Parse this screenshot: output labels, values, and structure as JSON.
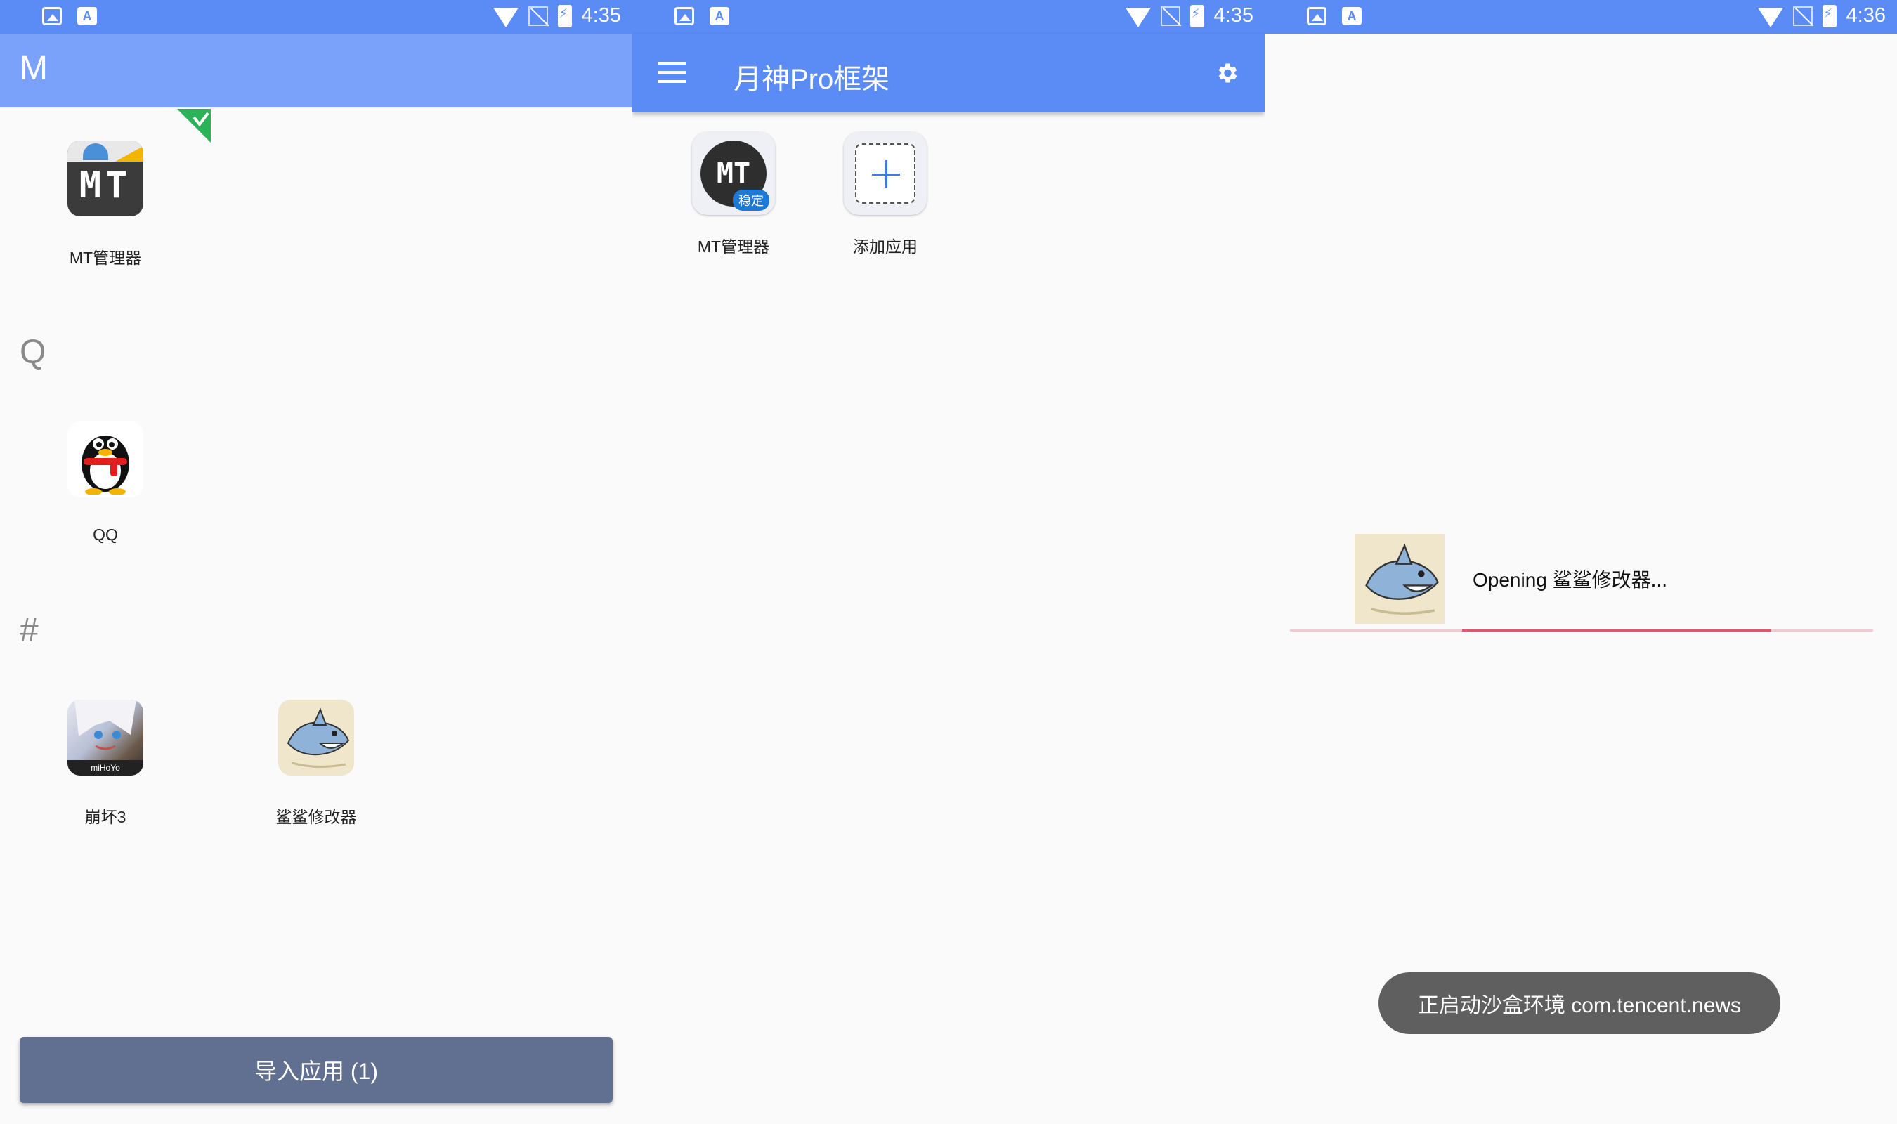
{
  "colors": {
    "primary": "#5b8cf5",
    "header_light": "#7aa2fb",
    "button": "#616f91",
    "progress": "#e8536c",
    "check": "#2bb35a"
  },
  "panels": [
    {
      "status": {
        "time": "4:35",
        "icons": [
          "image-icon",
          "a-icon",
          "wifi-icon",
          "no-signal-icon",
          "battery-charging-icon"
        ]
      },
      "sections": [
        {
          "letter": "M",
          "apps": [
            {
              "name": "MT管理器",
              "icon": "mt-manager-icon",
              "selected": true
            }
          ]
        },
        {
          "letter": "Q",
          "apps": [
            {
              "name": "QQ",
              "icon": "qq-penguin-icon"
            }
          ]
        },
        {
          "letter": "#",
          "apps": [
            {
              "name": "崩坏3",
              "icon": "honkai3-icon",
              "tag": "miHoYo"
            },
            {
              "name": "鲨鲨修改器",
              "icon": "shark-icon"
            }
          ]
        }
      ],
      "import_button": "导入应用 (1)"
    },
    {
      "status": {
        "time": "4:35",
        "icons": [
          "image-icon",
          "a-icon",
          "wifi-icon",
          "no-signal-icon",
          "battery-charging-icon"
        ]
      },
      "title": "月神Pro框架",
      "apps": [
        {
          "name": "MT管理器",
          "badge": "稳定",
          "icon": "mt-manager-icon"
        },
        {
          "name": "添加应用",
          "icon": "add-icon"
        }
      ]
    },
    {
      "status": {
        "time": "4:36",
        "icons": [
          "image-icon",
          "a-icon",
          "wifi-icon",
          "no-signal-icon",
          "battery-charging-icon"
        ]
      },
      "opening_text": "Opening 鲨鲨修改器...",
      "progress": 0.53,
      "toast": "正启动沙盒环境 com.tencent.news"
    }
  ]
}
